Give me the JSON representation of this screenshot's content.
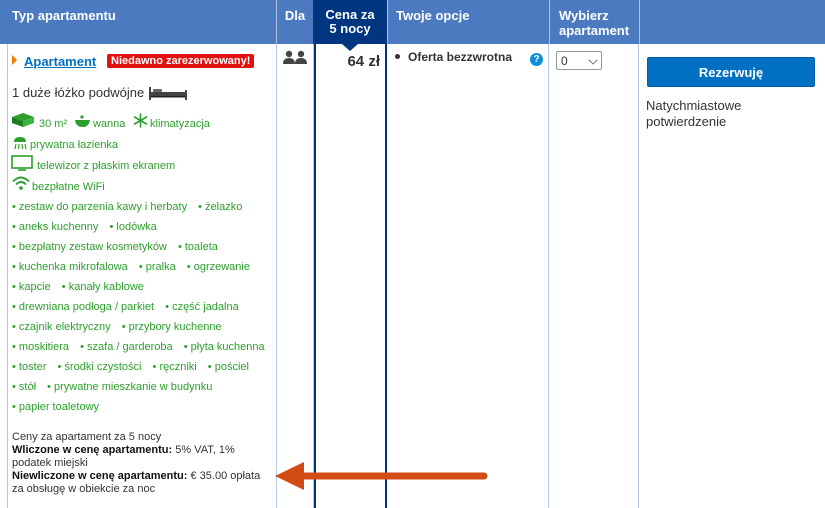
{
  "header": {
    "type": "Typ apartamentu",
    "for": "Dla",
    "price_line1": "Cena za",
    "price_line2": "5 nocy",
    "options": "Twoje opcje",
    "choose_line1": "Wybierz",
    "choose_line2": "apartament"
  },
  "room": {
    "name": "Apartament",
    "badge": "Niedawno zarezerwowany!",
    "bed": "1 duże łóżko podwójne",
    "size": "30 m²",
    "bath": "wanna",
    "ac": "klimatyzacja",
    "private_bathroom": "prywatna łazienka",
    "tv": "telewizor z płaskim ekranem",
    "wifi": "bezpłatne WiFi",
    "amenities": [
      [
        "zestaw do parzenia kawy i herbaty",
        "żelazko"
      ],
      [
        "aneks kuchenny",
        "lodówka"
      ],
      [
        "bezpłatny zestaw kosmetyków",
        "toaleta"
      ],
      [
        "kuchenka mikrofalowa",
        "pralka",
        "ogrzewanie"
      ],
      [
        "kapcie",
        "kanały kablowe"
      ],
      [
        "drewniana podłoga / parkiet",
        "część jadalna"
      ],
      [
        "czajnik elektryczny",
        "przybory kuchenne"
      ],
      [
        "moskitiera",
        "szafa / garderoba",
        "płyta kuchenna"
      ],
      [
        "toster",
        "środki czystości",
        "ręczniki",
        "pościel"
      ],
      [
        "stół",
        "prywatne mieszkanie w budynku"
      ],
      [
        "papier toaletowy"
      ]
    ],
    "prices_for": "Ceny za apartament za 5 nocy",
    "included_label": "Wliczone w cenę apartamentu:",
    "included_value": "5% VAT, 1% podatek miejski",
    "excluded_label": "Niewliczone w cenę apartamentu:",
    "excluded_value": "€ 35.00 opłata za obsługę w obiekcie za noc"
  },
  "price": "64 zł",
  "option": "Oferta bezzwrotna",
  "help_glyph": "?",
  "select_value": "0",
  "reserve_button": "Rezerwuję",
  "confirmation": "Natychmiastowe potwierdzenie",
  "colors": {
    "header": "#4b7ac0",
    "price_header": "#003580",
    "link": "#0071c2",
    "badge": "#e21111",
    "amenity": "#2d9f2d",
    "button": "#0071c2",
    "arrow": "#d24a14"
  }
}
